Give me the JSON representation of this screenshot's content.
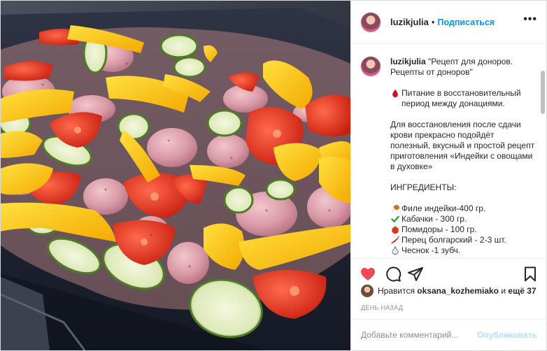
{
  "post": {
    "username": "luzikjulia",
    "follow_label": "Подписаться",
    "dot": "•",
    "more_label": "•••"
  },
  "caption": {
    "username": "luzikjulia",
    "title": "\"Рецепт для доноров. Рецепты от доноров\"",
    "paragraph1": "Питание в восстановительный период между донациями.",
    "paragraph2": "Для восстановления после сдачи крови прекрасно подойдёт полезный, вкусный и простой рецепт приготовления «Индейки с овощами в духовке»",
    "ingredients_heading": "ИНГРЕДИЕНТЫ:",
    "ingredients": [
      {
        "icon": "poultry-leg-icon",
        "text": "Филе индейки-400 гр."
      },
      {
        "icon": "check-mark-icon",
        "text": "Кабачки - 300 гр."
      },
      {
        "icon": "tomato-icon",
        "text": "Помидоры - 100 гр."
      },
      {
        "icon": "hot-pepper-icon",
        "text": "Перец болгарский - 2-3 шт."
      },
      {
        "icon": "garlic-icon",
        "text": "Чеснок -1 зубч."
      }
    ]
  },
  "likes": {
    "prefix": "Нравится",
    "user": "oksana_kozhemiako",
    "middle": "и",
    "more": "ещё 37"
  },
  "timestamp": "ДЕНЬ НАЗАД",
  "comment": {
    "placeholder": "Добавьте комментарий...",
    "publish_label": "Опубликовать"
  },
  "colors": {
    "accent": "#0095f6",
    "like_red": "#ed4956",
    "publish_disabled": "#b2dffc",
    "muted": "#8e8e8e"
  },
  "icons": {
    "like": "heart-filled-icon",
    "comment": "comment-icon",
    "share": "paper-plane-icon",
    "save": "bookmark-icon",
    "caption_bullet": "blood-drop-icon"
  }
}
